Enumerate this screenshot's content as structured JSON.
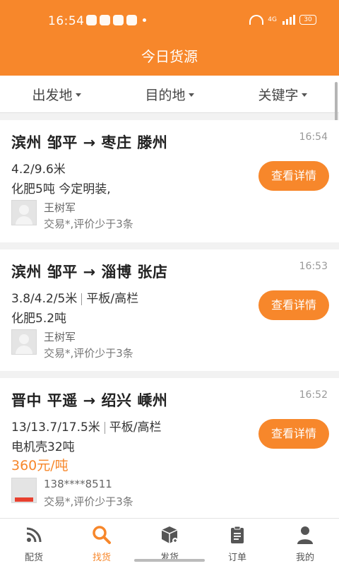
{
  "status_bar": {
    "time": "16:54",
    "network": "4G",
    "battery": "30"
  },
  "header": {
    "title": "今日货源"
  },
  "filters": [
    {
      "label": "出发地"
    },
    {
      "label": "目的地"
    },
    {
      "label": "关键字"
    }
  ],
  "cards": [
    {
      "route": "滨州 邹平 → 枣庄 滕州",
      "time": "16:54",
      "spec": [
        "4.2/9.6米"
      ],
      "cargo": "化肥5吨 今定明装,",
      "price": "",
      "user": "王树军",
      "rating": "交易*,评价少于3条",
      "button": "查看详情"
    },
    {
      "route": "滨州 邹平 → 淄博 张店",
      "time": "16:53",
      "spec": [
        "3.8/4.2/5米",
        "平板/高栏"
      ],
      "cargo": "化肥5.2吨",
      "price": "",
      "user": "王树军",
      "rating": "交易*,评价少于3条",
      "button": "查看详情"
    },
    {
      "route": "晋中 平遥 → 绍兴 嵊州",
      "time": "16:52",
      "spec": [
        "13/13.7/17.5米",
        "平板/高栏"
      ],
      "cargo": "电机壳32吨",
      "price": "360元/吨",
      "user": "138****8511",
      "rating": "交易*,评价少于3条",
      "button": "查看详情"
    }
  ],
  "tabs": [
    {
      "label": "配货",
      "icon": "rss-icon",
      "active": false
    },
    {
      "label": "找货",
      "icon": "search-icon",
      "active": true
    },
    {
      "label": "发货",
      "icon": "box-icon",
      "active": false
    },
    {
      "label": "订单",
      "icon": "clipboard-icon",
      "active": false
    },
    {
      "label": "我的",
      "icon": "user-icon",
      "active": false
    }
  ],
  "colors": {
    "accent": "#f7872b",
    "background": "#f2f2f2"
  }
}
